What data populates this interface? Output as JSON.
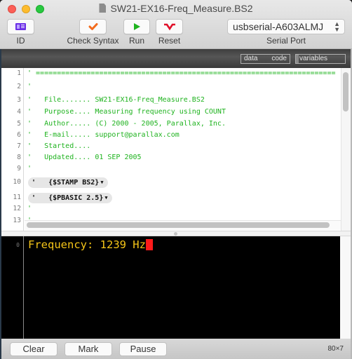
{
  "window": {
    "title": "SW21-EX16-Freq_Measure.BS2"
  },
  "toolbar": {
    "id_label": "ID",
    "check_syntax_label": "Check Syntax",
    "run_label": "Run",
    "reset_label": "Reset",
    "serial_port_label": "Serial Port",
    "serial_port_value": "usbserial-A603ALMJ",
    "icons": {
      "id": "id-card-icon",
      "check": "checkmark-icon",
      "run": "play-icon",
      "reset": "reset-icon"
    },
    "colors": {
      "id_icon": "#6b2ee6",
      "check_icon": "#f26b1d",
      "run_icon": "#1fb31f",
      "reset_icon": "#e0102a"
    }
  },
  "memory_bar": {
    "data_label": "data",
    "code_label": "code",
    "variables_label": "variables"
  },
  "editor": {
    "lines": [
      {
        "num": "1",
        "text": "' ======================================================================="
      },
      {
        "num": "2",
        "text": "'"
      },
      {
        "num": "3",
        "text": "'   File....... SW21-EX16-Freq_Measure.BS2"
      },
      {
        "num": "4",
        "text": "'   Purpose.... Measuring frequency using COUNT"
      },
      {
        "num": "5",
        "text": "'   Author..... (C) 2000 - 2005, Parallax, Inc."
      },
      {
        "num": "6",
        "text": "'   E-mail..... support@parallax.com"
      },
      {
        "num": "7",
        "text": "'   Started...."
      },
      {
        "num": "8",
        "text": "'   Updated.... 01 SEP 2005"
      },
      {
        "num": "9",
        "text": "'"
      },
      {
        "num": "10",
        "text": "'   {$STAMP BS2}",
        "directive": true
      },
      {
        "num": "11",
        "text": "'   {$PBASIC 2.5}",
        "directive": true
      },
      {
        "num": "12",
        "text": "'"
      },
      {
        "num": "13",
        "text": "'"
      }
    ],
    "comment_color": "#1fb31f"
  },
  "terminal": {
    "line_number": "0",
    "output": "Frequency: 1239 Hz",
    "text_color": "#f5c518",
    "cursor_color": "#ff1a1a",
    "dimensions": "80×7"
  },
  "bottom_bar": {
    "clear_label": "Clear",
    "mark_label": "Mark",
    "pause_label": "Pause"
  }
}
